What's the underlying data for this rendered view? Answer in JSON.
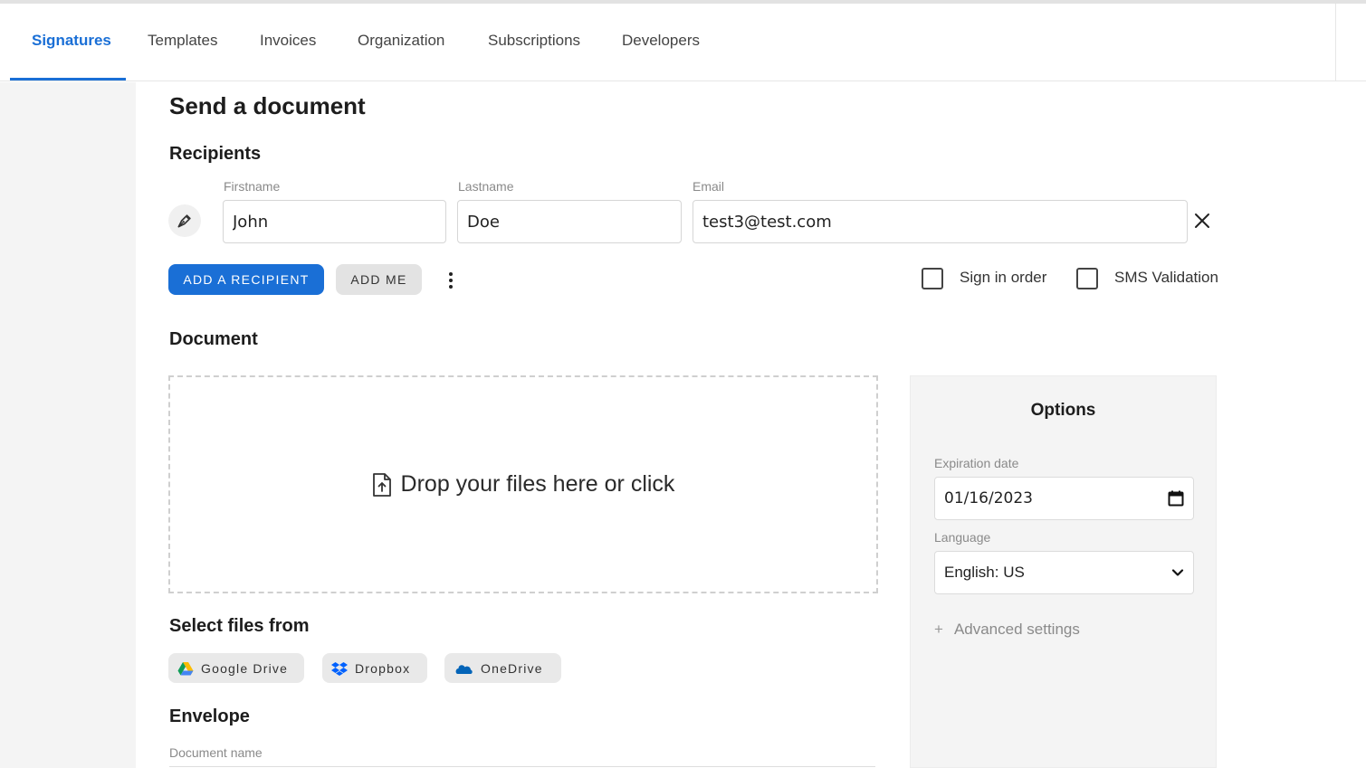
{
  "tabs": [
    {
      "label": "Signatures",
      "active": true
    },
    {
      "label": "Templates"
    },
    {
      "label": "Invoices"
    },
    {
      "label": "Organization"
    },
    {
      "label": "Subscriptions"
    },
    {
      "label": "Developers"
    }
  ],
  "page_title": "Send a document",
  "recipients": {
    "heading": "Recipients",
    "firstname_label": "Firstname",
    "lastname_label": "Lastname",
    "email_label": "Email",
    "firstname_value": "John",
    "lastname_value": "Doe",
    "email_value": "test3@test.com",
    "add_recipient_label": "ADD A RECIPIENT",
    "add_me_label": "ADD ME",
    "sign_in_order_label": "Sign in order",
    "sms_validation_label": "SMS Validation",
    "sign_in_order_checked": false,
    "sms_validation_checked": false
  },
  "document": {
    "heading": "Document",
    "dropzone_text": "Drop your files here or click"
  },
  "select_files": {
    "heading": "Select files from",
    "sources": [
      "Google Drive",
      "Dropbox",
      "OneDrive"
    ]
  },
  "envelope": {
    "heading": "Envelope",
    "document_name_label": "Document name"
  },
  "options": {
    "title": "Options",
    "expiration_label": "Expiration date",
    "expiration_value": "01/16/2023",
    "language_label": "Language",
    "language_value": "English: US",
    "advanced_label": "Advanced settings"
  },
  "colors": {
    "accent": "#1a6fd6",
    "sidebar_bg": "#f4f4f4",
    "options_bg": "#f4f4f4"
  },
  "icons": [
    "signer-pen-icon",
    "close-icon",
    "more-vertical-icon",
    "file-upload-icon",
    "google-drive-icon",
    "dropbox-icon",
    "onedrive-icon",
    "calendar-icon",
    "chevron-down-icon",
    "plus-icon"
  ]
}
